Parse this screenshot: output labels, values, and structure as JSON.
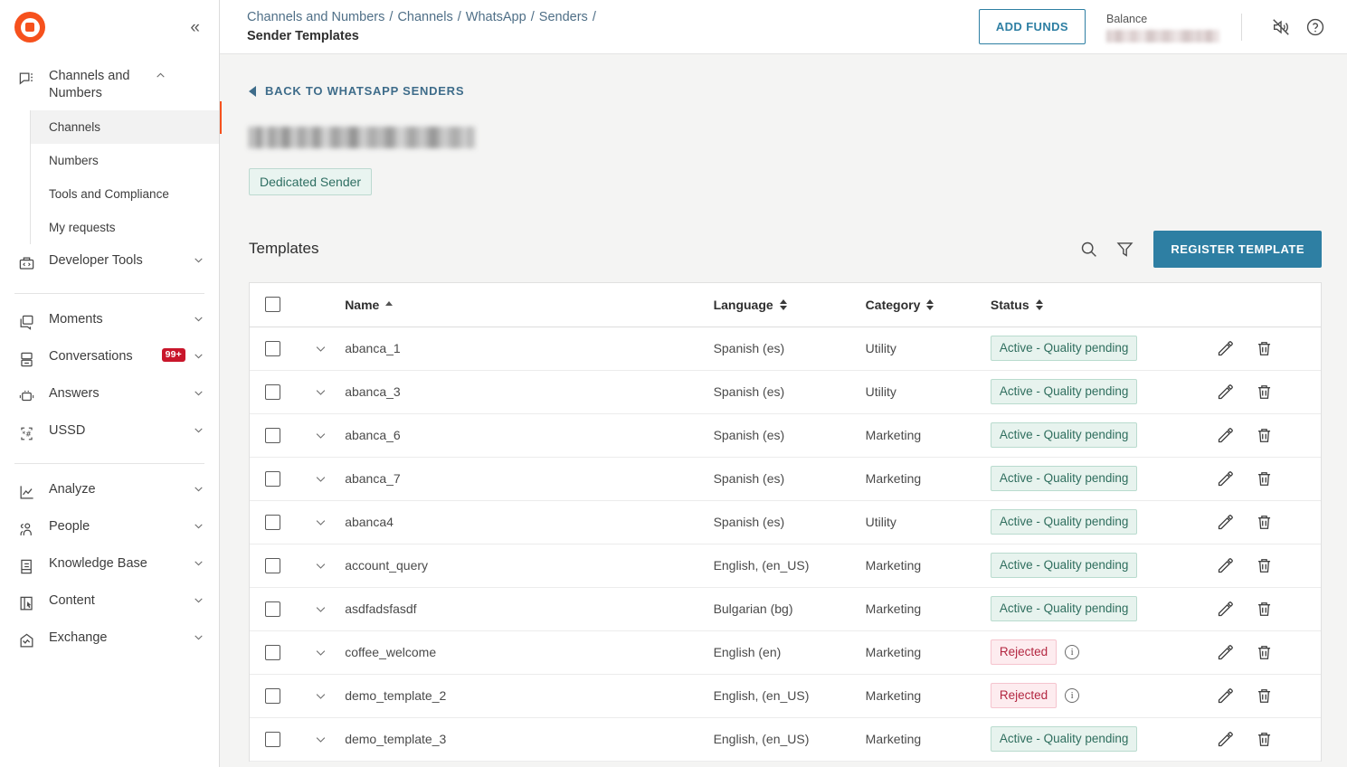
{
  "sidebar": {
    "logo_name": "infobip-logo",
    "collapse_label": "«",
    "groups": [
      {
        "label": "Channels and Numbers",
        "icon": "channels-icon",
        "expanded": true,
        "children": [
          {
            "label": "Channels",
            "active": true
          },
          {
            "label": "Numbers",
            "active": false
          },
          {
            "label": "Tools and Compliance",
            "active": false
          },
          {
            "label": "My requests",
            "active": false
          }
        ]
      },
      {
        "label": "Developer Tools",
        "icon": "developer-tools-icon",
        "badge": ""
      },
      {
        "label": "Moments",
        "icon": "moments-icon",
        "badge": ""
      },
      {
        "label": "Conversations",
        "icon": "conversations-icon",
        "badge": "99+"
      },
      {
        "label": "Answers",
        "icon": "answers-icon",
        "badge": ""
      },
      {
        "label": "USSD",
        "icon": "ussd-icon",
        "badge": ""
      },
      {
        "label": "Analyze",
        "icon": "analyze-icon",
        "badge": ""
      },
      {
        "label": "People",
        "icon": "people-icon",
        "badge": ""
      },
      {
        "label": "Knowledge Base",
        "icon": "knowledge-base-icon",
        "badge": ""
      },
      {
        "label": "Content",
        "icon": "content-icon",
        "badge": ""
      },
      {
        "label": "Exchange",
        "icon": "exchange-icon",
        "badge": ""
      }
    ]
  },
  "topbar": {
    "breadcrumb": [
      "Channels and Numbers",
      "Channels",
      "WhatsApp",
      "Senders"
    ],
    "breadcrumb_separator": "/",
    "page_title": "Sender Templates",
    "add_funds_label": "ADD FUNDS",
    "balance_label": "Balance",
    "balance_value_hidden": true,
    "mute_icon": "mute-bell-icon",
    "help_icon": "help-question-icon"
  },
  "content": {
    "back_link": "BACK TO WHATSAPP SENDERS",
    "sender_name_hidden": true,
    "sender_badge": "Dedicated Sender",
    "panel_title": "Templates",
    "search_icon": "search-icon",
    "filter_icon": "filter-icon",
    "register_button": "REGISTER TEMPLATE"
  },
  "table": {
    "columns": [
      {
        "key": "name",
        "label": "Name",
        "sort": "asc"
      },
      {
        "key": "language",
        "label": "Language",
        "sort": "none"
      },
      {
        "key": "category",
        "label": "Category",
        "sort": "none"
      },
      {
        "key": "status",
        "label": "Status",
        "sort": "none"
      }
    ],
    "rows": [
      {
        "name": "abanca_1",
        "language": "Spanish (es)",
        "category": "Utility",
        "status": "Active - Quality pending",
        "status_type": "green",
        "info": false
      },
      {
        "name": "abanca_3",
        "language": "Spanish (es)",
        "category": "Utility",
        "status": "Active - Quality pending",
        "status_type": "green",
        "info": false
      },
      {
        "name": "abanca_6",
        "language": "Spanish (es)",
        "category": "Marketing",
        "status": "Active - Quality pending",
        "status_type": "green",
        "info": false
      },
      {
        "name": "abanca_7",
        "language": "Spanish (es)",
        "category": "Marketing",
        "status": "Active - Quality pending",
        "status_type": "green",
        "info": false
      },
      {
        "name": "abanca4",
        "language": "Spanish (es)",
        "category": "Utility",
        "status": "Active - Quality pending",
        "status_type": "green",
        "info": false
      },
      {
        "name": "account_query",
        "language": "English, (en_US)",
        "category": "Marketing",
        "status": "Active - Quality pending",
        "status_type": "green",
        "info": false
      },
      {
        "name": "asdfadsfasdf",
        "language": "Bulgarian (bg)",
        "category": "Marketing",
        "status": "Active - Quality pending",
        "status_type": "green",
        "info": false
      },
      {
        "name": "coffee_welcome",
        "language": "English (en)",
        "category": "Marketing",
        "status": "Rejected",
        "status_type": "red",
        "info": true
      },
      {
        "name": "demo_template_2",
        "language": "English, (en_US)",
        "category": "Marketing",
        "status": "Rejected",
        "status_type": "red",
        "info": true
      },
      {
        "name": "demo_template_3",
        "language": "English, (en_US)",
        "category": "Marketing",
        "status": "Active - Quality pending",
        "status_type": "green",
        "info": false
      }
    ],
    "row_actions": {
      "edit_icon": "edit-pencil-icon",
      "delete_icon": "delete-trash-icon"
    },
    "info_glyph": "i"
  },
  "colors": {
    "brand_orange": "#F6511D",
    "accent_blue": "#2E7FA3",
    "link_blue": "#3E6C8A",
    "status_green_text": "#2F6E5E",
    "status_red_text": "#B32741",
    "badge_red": "#C9162B"
  }
}
